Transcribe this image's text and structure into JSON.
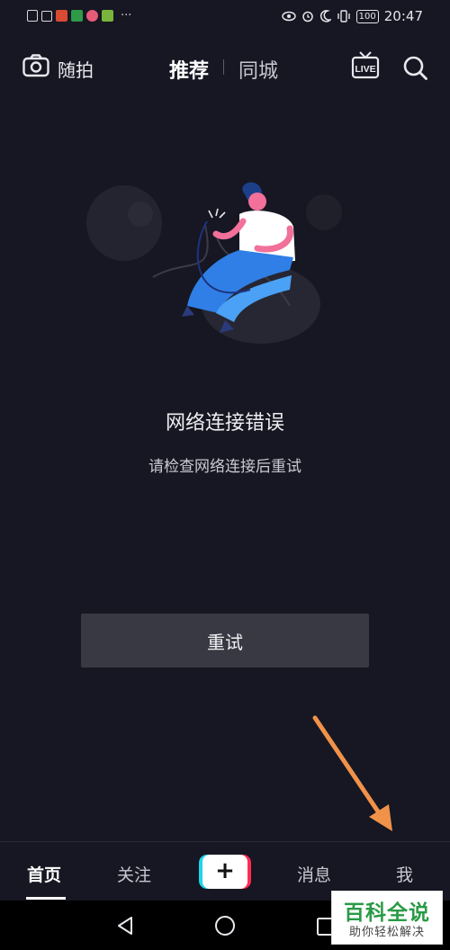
{
  "status_bar": {
    "time": "20:47",
    "battery": "100",
    "left_icons": [
      "sim-alert-icon",
      "activity-icon",
      "red-app-icon",
      "green-app-icon",
      "pink-app-icon",
      "lime-app-icon"
    ],
    "overflow": "···"
  },
  "top_bar": {
    "camera_label": "随拍",
    "tabs": [
      {
        "label": "推荐",
        "active": true
      },
      {
        "label": "同城",
        "active": false
      }
    ],
    "live_label": "LIVE"
  },
  "error": {
    "title": "网络连接错误",
    "subtitle": "请检查网络连接后重试",
    "retry_label": "重试"
  },
  "bottom_tabs": {
    "home": "首页",
    "follow": "关注",
    "create": "+",
    "messages": "消息",
    "me": "我"
  },
  "watermark": {
    "title": "百科全说",
    "subtitle": "助你轻松解决"
  },
  "colors": {
    "background": "#161722",
    "retry_button": "#383942",
    "annotation_arrow": "#f0924a",
    "plus_cyan": "#20d5ec",
    "plus_red": "#fe2c55",
    "watermark_green": "#2a9a46"
  }
}
